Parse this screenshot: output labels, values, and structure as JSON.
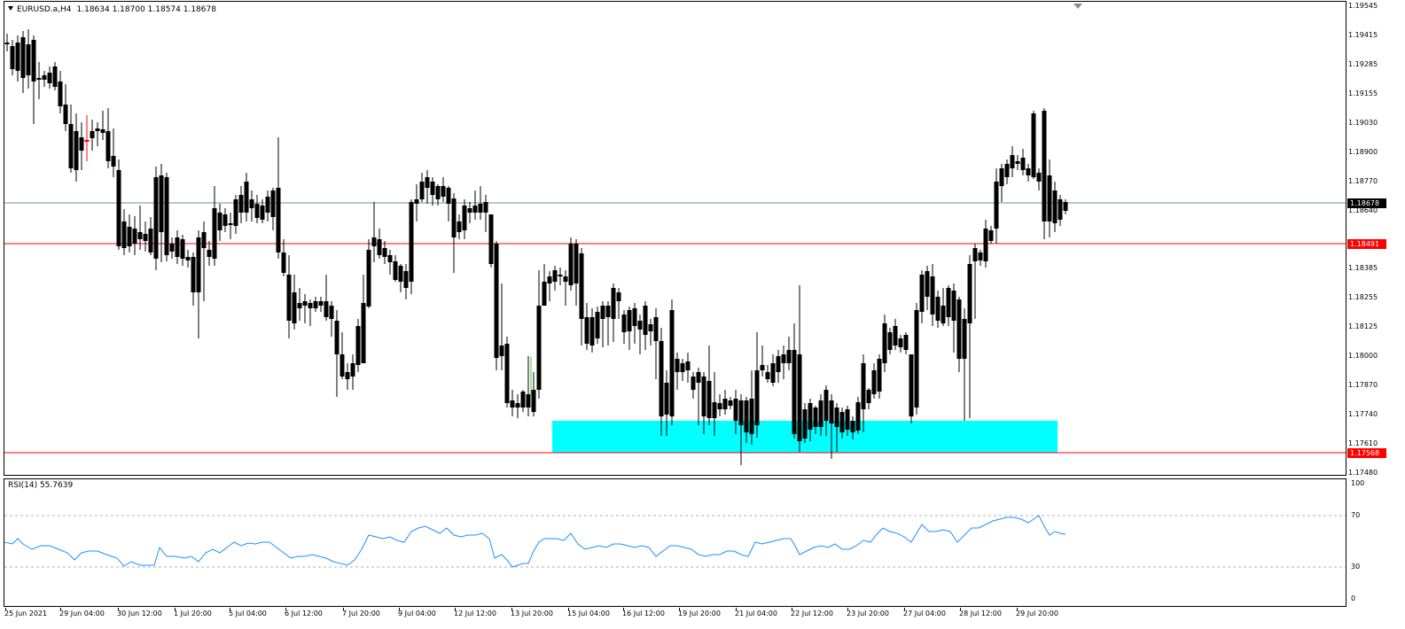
{
  "chart": {
    "symbol": "EURUSD.a,H4",
    "ohlc": "1.18634 1.18700 1.18574 1.18678",
    "current_price_tag": "1.18678",
    "resistance_tag": "1.18491",
    "support_tag": "1.17568"
  },
  "price_axis": [
    "1.19545",
    "1.19415",
    "1.19285",
    "1.19155",
    "1.19030",
    "1.18900",
    "1.18770",
    "1.18640",
    "1.18385",
    "1.18255",
    "1.18125",
    "1.18000",
    "1.17870",
    "1.17740",
    "1.17610",
    "1.17480"
  ],
  "time_axis": [
    "25 Jun 2021",
    "29 Jun 04:00",
    "30 Jun 12:00",
    "1 Jul 20:00",
    "5 Jul 04:00",
    "6 Jul 12:00",
    "7 Jul 20:00",
    "9 Jul 04:00",
    "12 Jul 12:00",
    "13 Jul 20:00",
    "15 Jul 04:00",
    "16 Jul 12:00",
    "19 Jul 20:00",
    "21 Jul 04:00",
    "22 Jul 12:00",
    "23 Jul 20:00",
    "27 Jul 04:00",
    "28 Jul 12:00",
    "29 Jul 20:00"
  ],
  "rsi": {
    "label": "RSI(14) 55.7639",
    "levels": [
      "100",
      "70",
      "30",
      "0"
    ]
  },
  "colors": {
    "bull": "#ff0000",
    "bear": "#000000",
    "zone": "#00ffff",
    "level_line": "#ff0000",
    "current_line": "#778899",
    "rsi_line": "#1e90ff"
  }
}
